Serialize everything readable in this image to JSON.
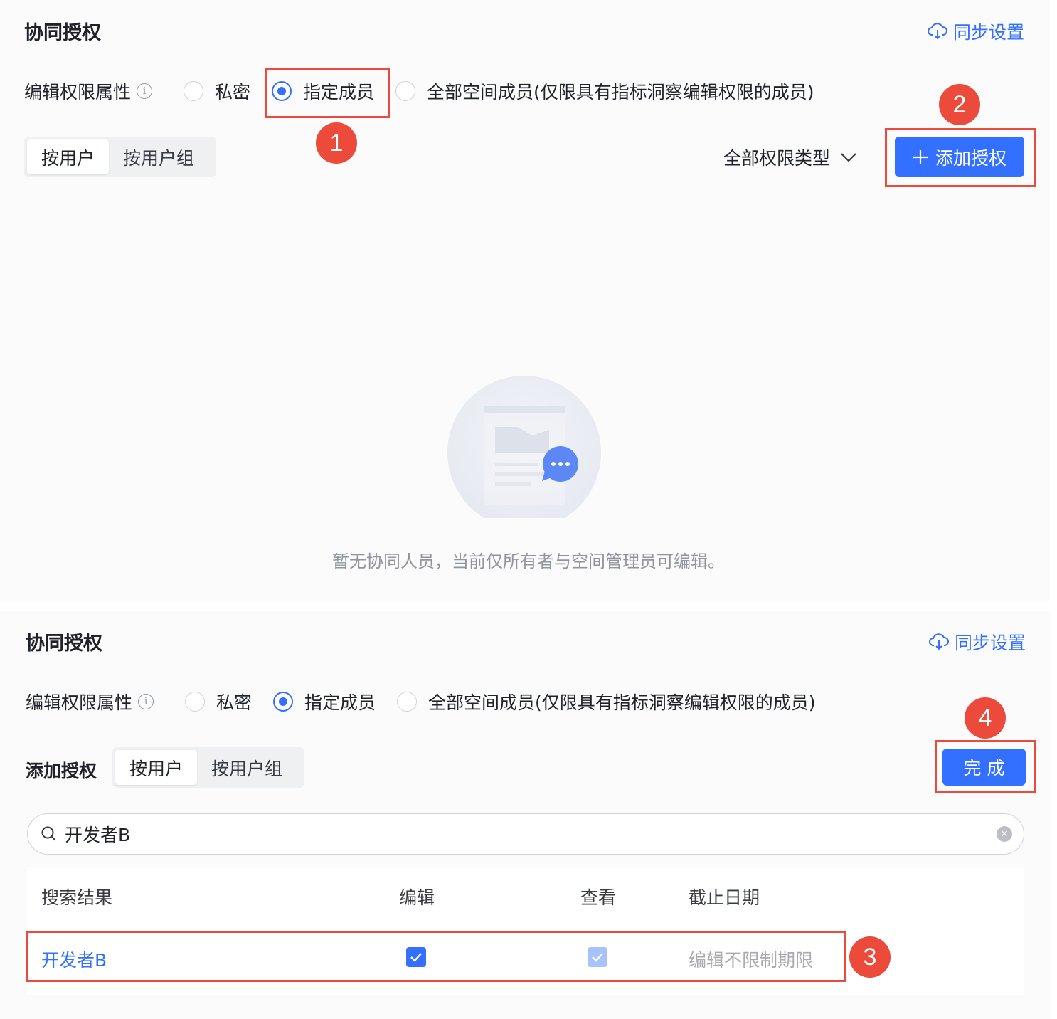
{
  "top": {
    "title": "协同授权",
    "sync_label": "同步设置",
    "attr_label": "编辑权限属性",
    "radios": [
      "私密",
      "指定成员",
      "全部空间成员(仅限具有指标洞察编辑权限的成员)"
    ],
    "selected_radio": "指定成员",
    "tabs": [
      "按用户",
      "按用户组"
    ],
    "active_tab": "按用户",
    "filter_label": "全部权限类型",
    "add_button": "添加授权",
    "empty_text": "暂无协同人员，当前仅所有者与空间管理员可编辑。"
  },
  "bottom": {
    "title": "协同授权",
    "sync_label": "同步设置",
    "attr_label": "编辑权限属性",
    "radios": [
      "私密",
      "指定成员",
      "全部空间成员(仅限具有指标洞察编辑权限的成员)"
    ],
    "selected_radio": "指定成员",
    "add_label": "添加授权",
    "tabs": [
      "按用户",
      "按用户组"
    ],
    "active_tab": "按用户",
    "done_button": "完 成",
    "search_value": "开发者B",
    "table": {
      "headers": [
        "搜索结果",
        "编辑",
        "查看",
        "截止日期"
      ],
      "rows": [
        {
          "name": "开发者B",
          "edit": true,
          "view": true,
          "view_disabled": true,
          "deadline": "编辑不限制期限"
        }
      ]
    }
  },
  "badges": [
    "1",
    "2",
    "3",
    "4"
  ],
  "colors": {
    "accent": "#3370ff",
    "highlight": "#ec4b3c",
    "muted": "#8f959e"
  }
}
